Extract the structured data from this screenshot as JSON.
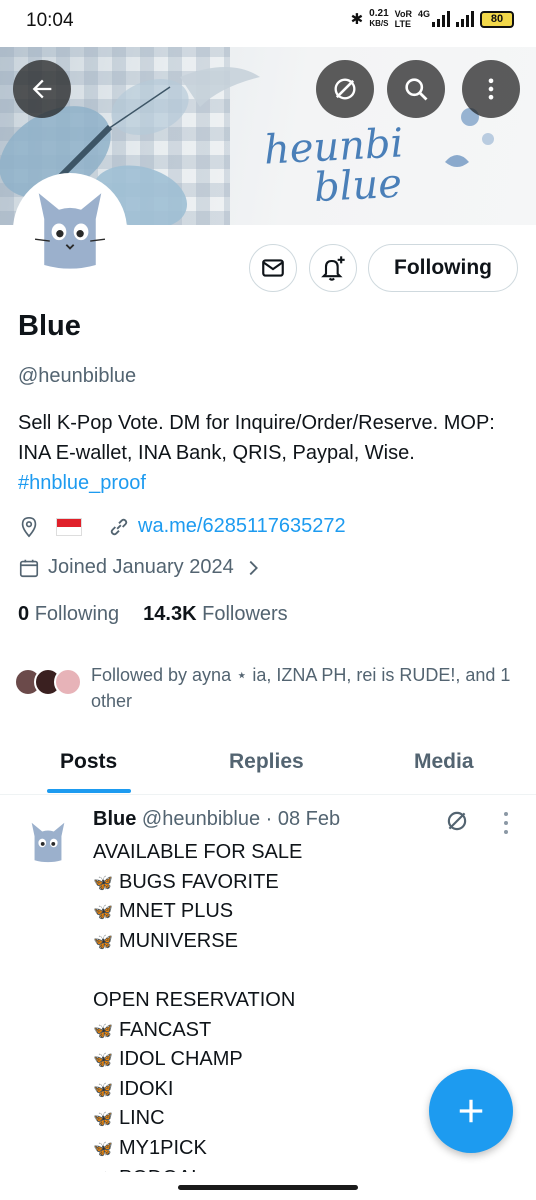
{
  "status_bar": {
    "time": "10:04",
    "speed_value": "0.21",
    "speed_unit": "KB/S",
    "volte_1": "VoR",
    "volte_2": "LTE",
    "network": "4G",
    "battery": "80"
  },
  "banner": {
    "brand_line1": "heunbi",
    "brand_line2": "blue"
  },
  "profile": {
    "name": "Blue",
    "handle": "@heunbiblue",
    "bio_text": "Sell K-Pop Vote. DM for Inquire/Order/Reserve. MOP: INA E-wallet, INA Bank, QRIS, Paypal, Wise.",
    "bio_hashtag": "#hnblue_proof",
    "website": "wa.me/6285117635272",
    "joined": "Joined January 2024",
    "following_count": "0",
    "following_label": "Following",
    "followers_count": "14.3K",
    "followers_label": "Followers",
    "followed_by": "Followed by ayna ⋆ ia, IZNA PH, rei is RUDE!, and 1 other"
  },
  "actions": {
    "follow_button": "Following"
  },
  "tabs": [
    {
      "label": "Posts"
    },
    {
      "label": "Replies"
    },
    {
      "label": "Media"
    }
  ],
  "post": {
    "author": "Blue",
    "meta": "@heunbiblue · 08 Feb",
    "lines": [
      {
        "icon": "butterfly",
        "text": "AVAILABLE FOR SALE"
      },
      {
        "icon": "butterfly",
        "text": "BUGS FAVORITE"
      },
      {
        "icon": "butterfly",
        "text": "MNET PLUS"
      },
      {
        "icon": "butterfly",
        "text": "MUNIVERSE"
      },
      {
        "icon": "",
        "text": ""
      },
      {
        "icon": "",
        "text": "OPEN RESERVATION"
      },
      {
        "icon": "butterfly",
        "text": "FANCAST"
      },
      {
        "icon": "butterfly",
        "text": "IDOL CHAMP"
      },
      {
        "icon": "butterfly",
        "text": "IDOKI"
      },
      {
        "icon": "butterfly",
        "text": "LINC"
      },
      {
        "icon": "butterfly",
        "text": "MY1PICK"
      },
      {
        "icon": "butterfly",
        "text": "PODOAL"
      }
    ]
  },
  "colors": {
    "accent": "#1d9bf0",
    "text": "#0f1419",
    "muted": "#536471",
    "cat": "#9bb0cc"
  }
}
